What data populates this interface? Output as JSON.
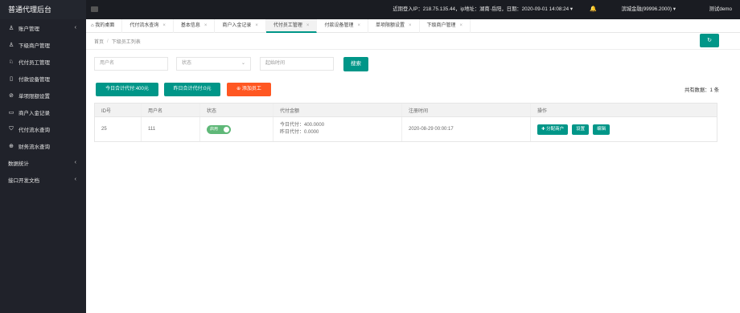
{
  "app": {
    "title": "普通代理后台"
  },
  "sidebar": {
    "items": [
      {
        "label": "账户管理",
        "icon": "user-icon",
        "arrow": "‹"
      },
      {
        "label": "下级商户管理",
        "icon": "user-icon",
        "arrow": ""
      },
      {
        "label": "代付员工管理",
        "icon": "users-icon",
        "arrow": ""
      },
      {
        "label": "付款设备管理",
        "icon": "device-icon",
        "arrow": ""
      },
      {
        "label": "单项限额设置",
        "icon": "limit-icon",
        "arrow": ""
      },
      {
        "label": "商户入金记录",
        "icon": "inbox-icon",
        "arrow": ""
      },
      {
        "label": "代付流水查询",
        "icon": "shield-icon",
        "arrow": ""
      },
      {
        "label": "财务流水查询",
        "icon": "money-icon",
        "arrow": ""
      },
      {
        "label": "数据统计",
        "icon": "",
        "arrow": "‹"
      },
      {
        "label": "接口开发文档",
        "icon": "",
        "arrow": "‹"
      }
    ]
  },
  "header": {
    "login_info": "近期登入IP：218.75.135.44，ip地址：湖南·岳阳，日期：2020-09-01 14:08:24 ▾",
    "balance": "滨城金融(99996.2000) ▾",
    "user": "测试demo"
  },
  "tabs": [
    {
      "label": "我的桌面",
      "closable": false
    },
    {
      "label": "代付流水查询",
      "closable": true
    },
    {
      "label": "基本信息",
      "closable": true
    },
    {
      "label": "商户入金记录",
      "closable": true
    },
    {
      "label": "代付员工管理",
      "closable": true,
      "active": true
    },
    {
      "label": "付款设备管理",
      "closable": true
    },
    {
      "label": "单项限额设置",
      "closable": true
    },
    {
      "label": "下级商户管理",
      "closable": true
    }
  ],
  "breadcrumb": {
    "home": "首页",
    "sep": "/",
    "current": "下级员工列表"
  },
  "refresh_label": "↻",
  "filters": {
    "username_placeholder": "用户名",
    "status_placeholder": "状态",
    "date_placeholder": "起始时间",
    "search_label": "搜索"
  },
  "stats": {
    "today_total": "今日合计代付:400元",
    "yesterday_total": "昨日合计代付:0元",
    "add_label": "⊕ 添加员工",
    "total_records": "共有数据：1 条"
  },
  "table": {
    "headers": [
      "ID号",
      "用户名",
      "状态",
      "代付金额",
      "注册时间",
      "操作"
    ],
    "rows": [
      {
        "id": "25",
        "username": "111",
        "status": "启用",
        "today": "今日代付：400.0000",
        "yesterday": "昨日代付：0.0000",
        "reg_time": "2020-08-29 00:00:17",
        "actions": [
          "✚ 分配商户",
          "设置",
          "编辑"
        ]
      }
    ]
  },
  "colors": {
    "primary": "#009688",
    "danger": "#ff5722",
    "sidebar": "#20222a",
    "toggle": "#5fb878"
  }
}
